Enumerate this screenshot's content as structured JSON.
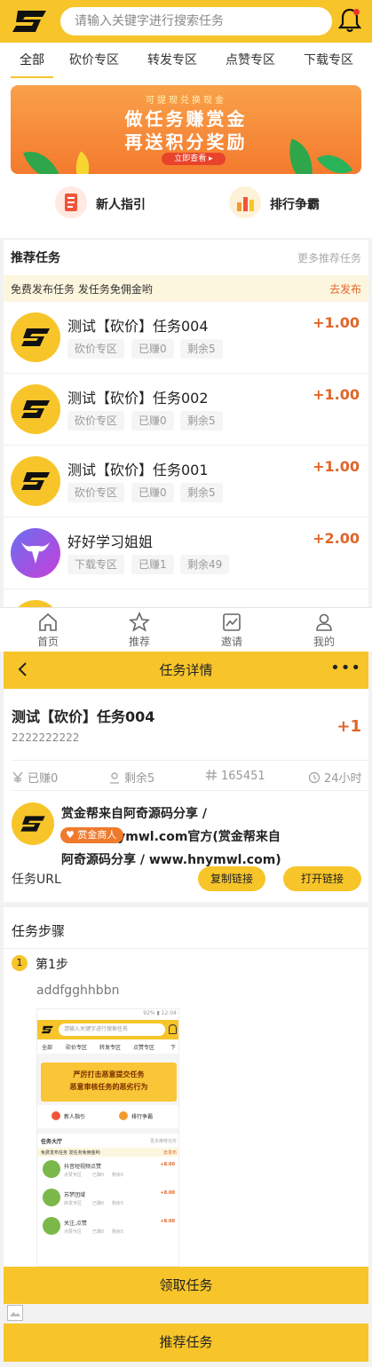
{
  "search": {
    "placeholder": "请输入关键字进行搜索任务"
  },
  "tabs": [
    {
      "label": "全部",
      "active": true
    },
    {
      "label": "砍价专区"
    },
    {
      "label": "转发专区"
    },
    {
      "label": "点赞专区"
    },
    {
      "label": "下载专区"
    }
  ],
  "banner": {
    "subtitle": "可提现兑换现金",
    "title1": "做任务赚赏金",
    "title2": "再送积分奖励",
    "button": "立即查看 ▸"
  },
  "shortcuts": [
    {
      "label": "新人指引",
      "icon": "guide-icon"
    },
    {
      "label": "排行争霸",
      "icon": "rank-icon"
    }
  ],
  "recommend": {
    "title": "推荐任务",
    "more": "更多推荐任务",
    "notice": "免费发布任务 发任务免佣金哟",
    "notice_link": "去发布",
    "items": [
      {
        "title": "测试【砍价】任务004",
        "reward": "+1.00",
        "tags": [
          "砍价专区",
          "已赚0",
          "剩余5"
        ],
        "avatar": "s-logo"
      },
      {
        "title": "测试【砍价】任务002",
        "reward": "+1.00",
        "tags": [
          "砍价专区",
          "已赚0",
          "剩余5"
        ],
        "avatar": "s-logo"
      },
      {
        "title": "测试【砍价】任务001",
        "reward": "+1.00",
        "tags": [
          "砍价专区",
          "已赚0",
          "剩余5"
        ],
        "avatar": "s-logo"
      },
      {
        "title": "好好学习姐姐",
        "reward": "+2.00",
        "tags": [
          "下载专区",
          "已赚1",
          "剩余49"
        ],
        "avatar": "bull-logo"
      }
    ]
  },
  "bottom_nav": [
    {
      "label": "首页",
      "icon": "home-icon"
    },
    {
      "label": "推荐",
      "icon": "star-icon"
    },
    {
      "label": "邀请",
      "icon": "chart-icon"
    },
    {
      "label": "我的",
      "icon": "user-icon"
    }
  ],
  "detail": {
    "header_title": "任务详情",
    "more": "•••",
    "title": "测试【砍价】任务004",
    "subtitle": "2222222222",
    "reward": "+1",
    "stats": [
      {
        "icon": "yen-icon",
        "label": "已赚0"
      },
      {
        "icon": "person-icon",
        "label": "剩余5"
      },
      {
        "icon": "hash-icon",
        "label": "165451"
      },
      {
        "icon": "clock-icon",
        "label": "24小时"
      }
    ],
    "publisher": {
      "name": "赏金帮来自阿奇源码分享 / www.hnymwl.com官方(赏金帮来自阿奇源码分享 / www.hnymwl.com)",
      "badge": "赏金商人"
    },
    "url_label": "任务URL",
    "copy_button": "复制链接",
    "open_button": "打开链接"
  },
  "steps": {
    "title": "任务步骤",
    "step_number": "1",
    "step_label": "第1步",
    "step_desc": "addfgghhbbn",
    "screenshot": {
      "status": "92% ▮ 12:04",
      "search_placeholder": "请输入关键字进行搜索任务",
      "tabs": [
        "全部",
        "砍价专区",
        "转发专区",
        "点赞专区",
        "下"
      ],
      "banner_line1": "严厉打击恶意提交任务",
      "banner_line2": "恶意审核任务的恶劣行为",
      "shortcuts": [
        "新人指引",
        "排行争霸"
      ],
      "hall_title": "任务大厅",
      "hall_more": "更多推荐任务",
      "notice": "免费发布任务 发任务免佣金哟",
      "notice_link": "去发布",
      "items": [
        {
          "title": "抖音短视频点赞",
          "reward": "+8.00",
          "tags": [
            "点赞专区",
            "已赚0",
            "剩余5"
          ]
        },
        {
          "title": "苏梦团域",
          "reward": "+8.00",
          "tags": [
            "转发专区",
            "已赚0",
            "剩余5"
          ]
        },
        {
          "title": "关注,点赞",
          "reward": "+8.00",
          "tags": [
            "点赞专区",
            "已赚0",
            "剩余5"
          ]
        }
      ]
    }
  },
  "footer": {
    "claim_button": "领取任务",
    "recommend_button": "推荐任务"
  },
  "colors": {
    "brand": "#f7c52a",
    "reward": "#e0662a"
  }
}
